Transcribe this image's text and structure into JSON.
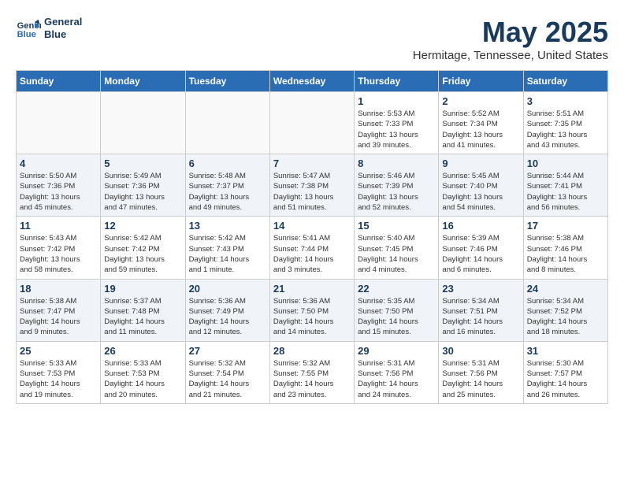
{
  "header": {
    "logo_line1": "General",
    "logo_line2": "Blue",
    "title": "May 2025",
    "subtitle": "Hermitage, Tennessee, United States"
  },
  "columns": [
    "Sunday",
    "Monday",
    "Tuesday",
    "Wednesday",
    "Thursday",
    "Friday",
    "Saturday"
  ],
  "weeks": [
    [
      {
        "day": "",
        "info": ""
      },
      {
        "day": "",
        "info": ""
      },
      {
        "day": "",
        "info": ""
      },
      {
        "day": "",
        "info": ""
      },
      {
        "day": "1",
        "info": "Sunrise: 5:53 AM\nSunset: 7:33 PM\nDaylight: 13 hours\nand 39 minutes."
      },
      {
        "day": "2",
        "info": "Sunrise: 5:52 AM\nSunset: 7:34 PM\nDaylight: 13 hours\nand 41 minutes."
      },
      {
        "day": "3",
        "info": "Sunrise: 5:51 AM\nSunset: 7:35 PM\nDaylight: 13 hours\nand 43 minutes."
      }
    ],
    [
      {
        "day": "4",
        "info": "Sunrise: 5:50 AM\nSunset: 7:36 PM\nDaylight: 13 hours\nand 45 minutes."
      },
      {
        "day": "5",
        "info": "Sunrise: 5:49 AM\nSunset: 7:36 PM\nDaylight: 13 hours\nand 47 minutes."
      },
      {
        "day": "6",
        "info": "Sunrise: 5:48 AM\nSunset: 7:37 PM\nDaylight: 13 hours\nand 49 minutes."
      },
      {
        "day": "7",
        "info": "Sunrise: 5:47 AM\nSunset: 7:38 PM\nDaylight: 13 hours\nand 51 minutes."
      },
      {
        "day": "8",
        "info": "Sunrise: 5:46 AM\nSunset: 7:39 PM\nDaylight: 13 hours\nand 52 minutes."
      },
      {
        "day": "9",
        "info": "Sunrise: 5:45 AM\nSunset: 7:40 PM\nDaylight: 13 hours\nand 54 minutes."
      },
      {
        "day": "10",
        "info": "Sunrise: 5:44 AM\nSunset: 7:41 PM\nDaylight: 13 hours\nand 56 minutes."
      }
    ],
    [
      {
        "day": "11",
        "info": "Sunrise: 5:43 AM\nSunset: 7:42 PM\nDaylight: 13 hours\nand 58 minutes."
      },
      {
        "day": "12",
        "info": "Sunrise: 5:42 AM\nSunset: 7:42 PM\nDaylight: 13 hours\nand 59 minutes."
      },
      {
        "day": "13",
        "info": "Sunrise: 5:42 AM\nSunset: 7:43 PM\nDaylight: 14 hours\nand 1 minute."
      },
      {
        "day": "14",
        "info": "Sunrise: 5:41 AM\nSunset: 7:44 PM\nDaylight: 14 hours\nand 3 minutes."
      },
      {
        "day": "15",
        "info": "Sunrise: 5:40 AM\nSunset: 7:45 PM\nDaylight: 14 hours\nand 4 minutes."
      },
      {
        "day": "16",
        "info": "Sunrise: 5:39 AM\nSunset: 7:46 PM\nDaylight: 14 hours\nand 6 minutes."
      },
      {
        "day": "17",
        "info": "Sunrise: 5:38 AM\nSunset: 7:46 PM\nDaylight: 14 hours\nand 8 minutes."
      }
    ],
    [
      {
        "day": "18",
        "info": "Sunrise: 5:38 AM\nSunset: 7:47 PM\nDaylight: 14 hours\nand 9 minutes."
      },
      {
        "day": "19",
        "info": "Sunrise: 5:37 AM\nSunset: 7:48 PM\nDaylight: 14 hours\nand 11 minutes."
      },
      {
        "day": "20",
        "info": "Sunrise: 5:36 AM\nSunset: 7:49 PM\nDaylight: 14 hours\nand 12 minutes."
      },
      {
        "day": "21",
        "info": "Sunrise: 5:36 AM\nSunset: 7:50 PM\nDaylight: 14 hours\nand 14 minutes."
      },
      {
        "day": "22",
        "info": "Sunrise: 5:35 AM\nSunset: 7:50 PM\nDaylight: 14 hours\nand 15 minutes."
      },
      {
        "day": "23",
        "info": "Sunrise: 5:34 AM\nSunset: 7:51 PM\nDaylight: 14 hours\nand 16 minutes."
      },
      {
        "day": "24",
        "info": "Sunrise: 5:34 AM\nSunset: 7:52 PM\nDaylight: 14 hours\nand 18 minutes."
      }
    ],
    [
      {
        "day": "25",
        "info": "Sunrise: 5:33 AM\nSunset: 7:53 PM\nDaylight: 14 hours\nand 19 minutes."
      },
      {
        "day": "26",
        "info": "Sunrise: 5:33 AM\nSunset: 7:53 PM\nDaylight: 14 hours\nand 20 minutes."
      },
      {
        "day": "27",
        "info": "Sunrise: 5:32 AM\nSunset: 7:54 PM\nDaylight: 14 hours\nand 21 minutes."
      },
      {
        "day": "28",
        "info": "Sunrise: 5:32 AM\nSunset: 7:55 PM\nDaylight: 14 hours\nand 23 minutes."
      },
      {
        "day": "29",
        "info": "Sunrise: 5:31 AM\nSunset: 7:56 PM\nDaylight: 14 hours\nand 24 minutes."
      },
      {
        "day": "30",
        "info": "Sunrise: 5:31 AM\nSunset: 7:56 PM\nDaylight: 14 hours\nand 25 minutes."
      },
      {
        "day": "31",
        "info": "Sunrise: 5:30 AM\nSunset: 7:57 PM\nDaylight: 14 hours\nand 26 minutes."
      }
    ]
  ]
}
